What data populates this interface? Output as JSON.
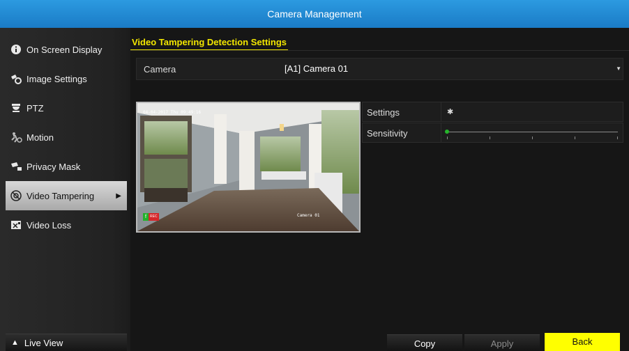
{
  "window": {
    "title": "Camera Management"
  },
  "sidebar": {
    "items": [
      {
        "label": "On Screen Display",
        "icon": "info-icon"
      },
      {
        "label": "Image Settings",
        "icon": "image-settings-icon"
      },
      {
        "label": "PTZ",
        "icon": "ptz-camera-icon"
      },
      {
        "label": "Motion",
        "icon": "motion-icon"
      },
      {
        "label": "Privacy Mask",
        "icon": "privacy-mask-icon"
      },
      {
        "label": "Video Tampering",
        "icon": "tampering-icon",
        "active": true
      },
      {
        "label": "Video Loss",
        "icon": "video-loss-icon"
      }
    ],
    "live_view": "Live View"
  },
  "main": {
    "tab": "Video Tampering Detection Settings",
    "camera_label": "Camera",
    "camera_value": "[A1] Camera 01",
    "preview": {
      "osd_time": "04-04-2017  Thu 09:49:16",
      "osd_name": "Camera 01",
      "rec_label": "REC"
    },
    "settings_label": "Settings",
    "sensitivity_label": "Sensitivity",
    "sensitivity_level": 0.0
  },
  "buttons": {
    "copy": "Copy",
    "apply": "Apply",
    "back": "Back"
  },
  "colors": {
    "title_bar": "#1f88d4",
    "accent": "#f2e600",
    "back_button": "#ffff00",
    "slider_knob": "#25b52b"
  }
}
